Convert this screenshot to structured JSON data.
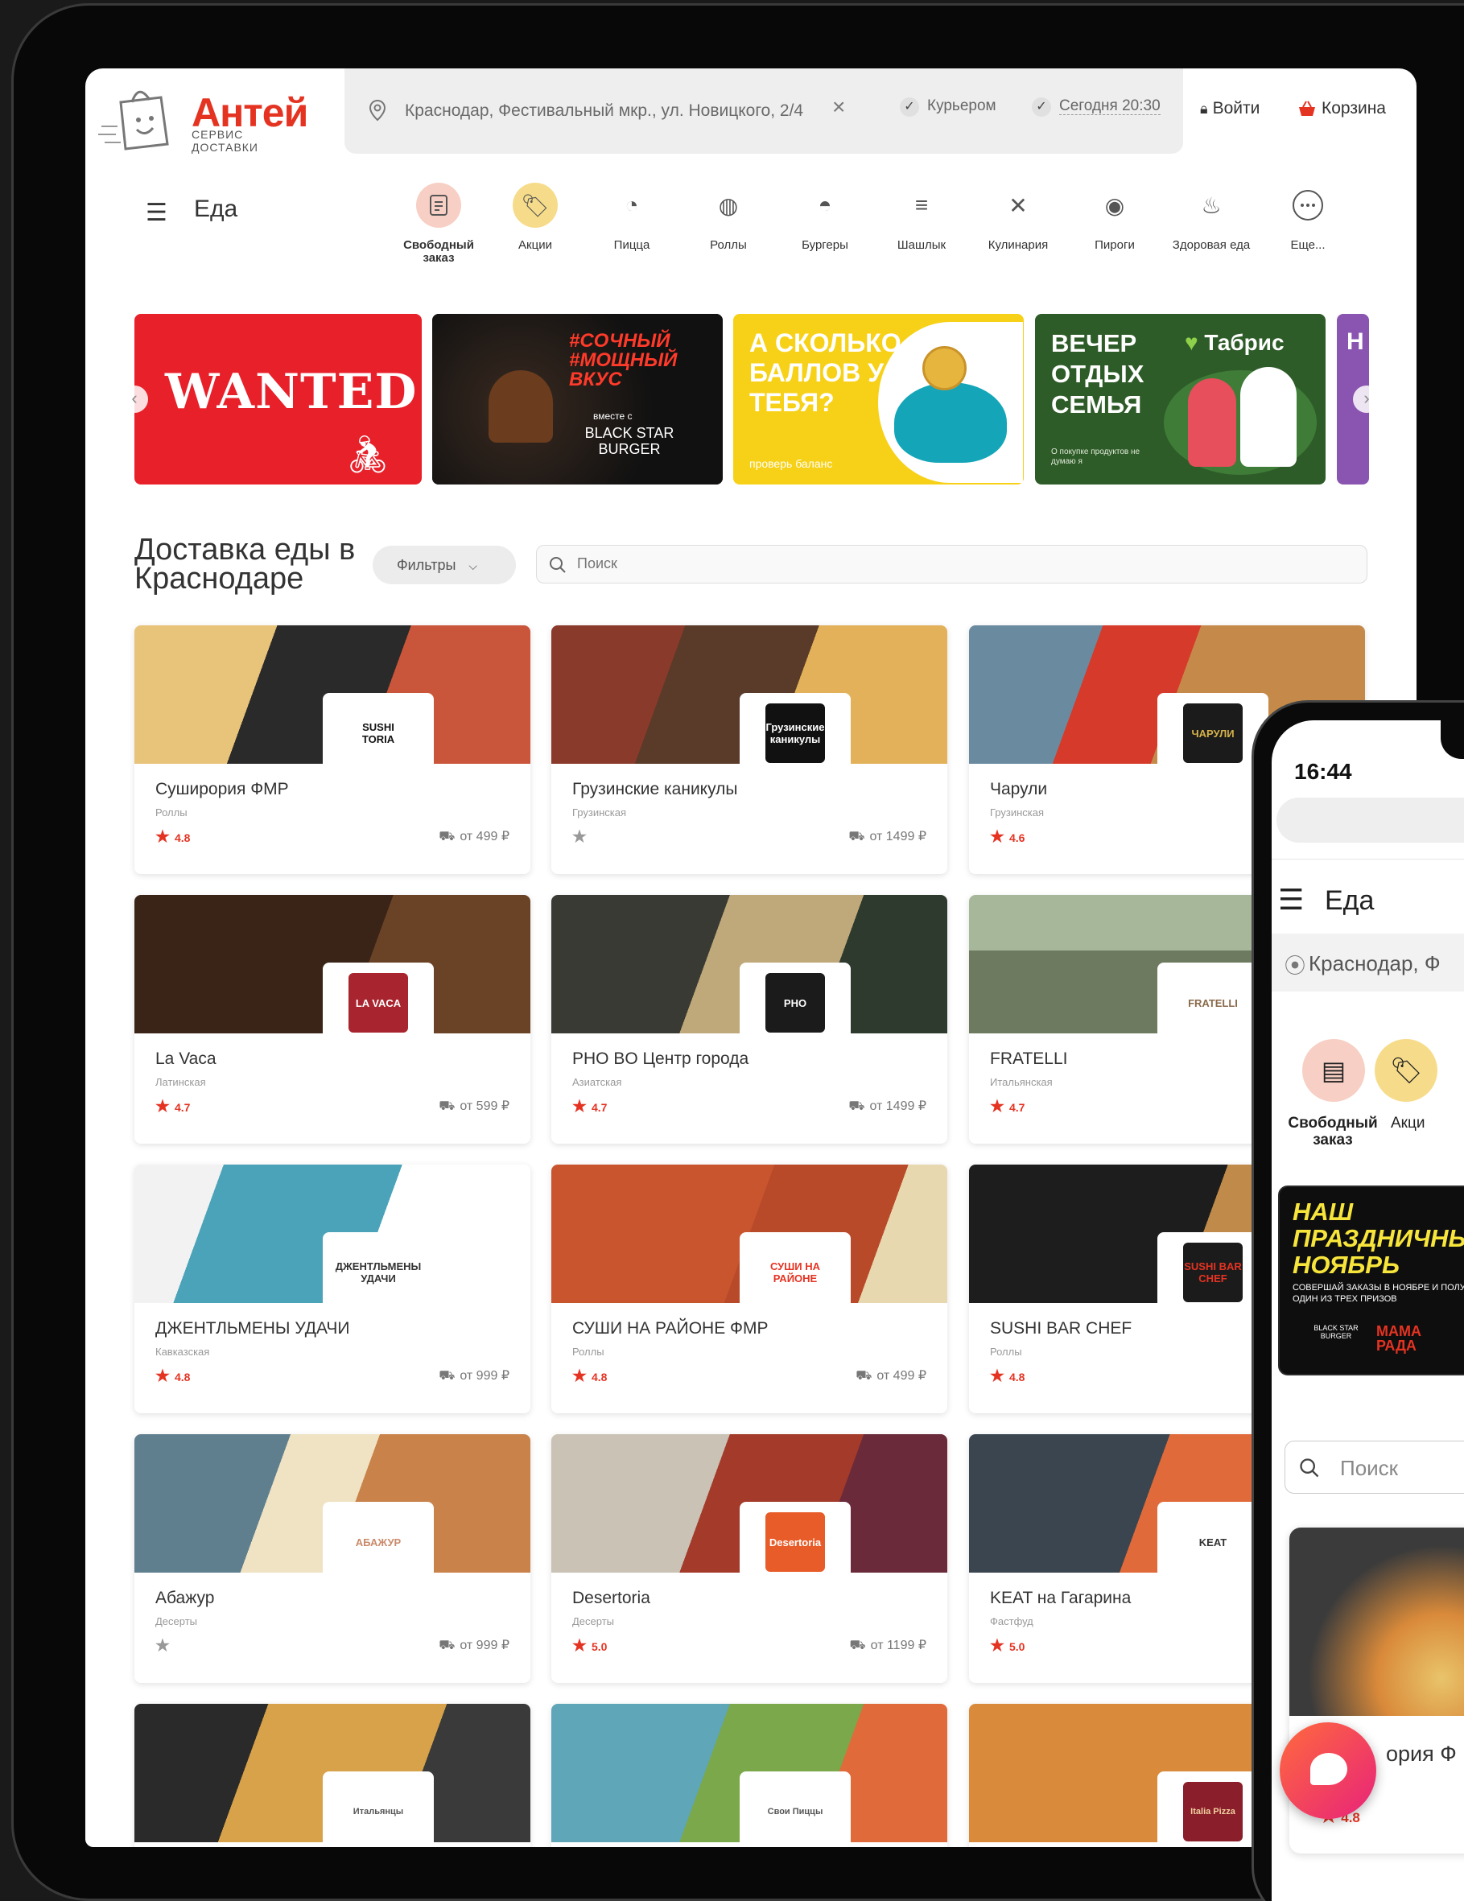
{
  "header": {
    "logo_name": "Антей",
    "logo_sub": "СЕРВИС ДОСТАВКИ",
    "address": "Краснодар, Фестивальный мкр., ул. Новицкого, 2/4",
    "delivery_mode": "Курьером",
    "delivery_time": "Сегодня 20:30",
    "login_label": "Войти",
    "cart_label": "Корзина"
  },
  "nav": {
    "menu_label": "Еда",
    "categories": [
      {
        "label": "Свободный заказ",
        "icon": "list-icon"
      },
      {
        "label": "Акции",
        "icon": "tag-icon"
      },
      {
        "label": "Пицца",
        "icon": "pizza-icon"
      },
      {
        "label": "Роллы",
        "icon": "rolls-icon"
      },
      {
        "label": "Бургеры",
        "icon": "burger-icon"
      },
      {
        "label": "Шашлык",
        "icon": "kebab-icon"
      },
      {
        "label": "Кулинария",
        "icon": "cooking-icon"
      },
      {
        "label": "Пироги",
        "icon": "pie-icon"
      },
      {
        "label": "Здоровая еда",
        "icon": "healthy-icon"
      },
      {
        "label": "Еще...",
        "icon": "more-icon"
      }
    ]
  },
  "banners": [
    {
      "text": "WANTED"
    },
    {
      "text": "#СОЧНЫЙ #МОЩНЫЙ ВКУС",
      "sub": "вместе с",
      "brand": "BLACK STAR BURGER"
    },
    {
      "text": "А СКОЛЬКО БАЛЛОВ У ТЕБЯ?",
      "sub": "проверь баланс"
    },
    {
      "text": "ВЕЧЕР ОТДЫХ СЕМЬЯ",
      "brand": "Табрис",
      "sub": "О покупке продуктов не думаю я"
    },
    {
      "text": "Н"
    }
  ],
  "section": {
    "title": "Доставка еды в Краснодаре",
    "filter_label": "Фильтры",
    "search_placeholder": "Поиск"
  },
  "restaurants": [
    {
      "name": "Суширория ФМР",
      "cuisine": "Роллы",
      "rating": "4.8",
      "price": "от 499 ₽",
      "logo": "SUSHI TORIA"
    },
    {
      "name": "Грузинские каникулы",
      "cuisine": "Грузинская",
      "rating": "",
      "price": "от 1499 ₽",
      "logo": "Грузинские каникулы"
    },
    {
      "name": "Чарули",
      "cuisine": "Грузинская",
      "rating": "4.6",
      "price": "",
      "logo": "ЧАРУЛИ"
    },
    {
      "name": "La Vaca",
      "cuisine": "Латинская",
      "rating": "4.7",
      "price": "от 599 ₽",
      "logo": "LA VACA"
    },
    {
      "name": "PHO BO Центр города",
      "cuisine": "Азиатская",
      "rating": "4.7",
      "price": "от 1499 ₽",
      "logo": "PHO"
    },
    {
      "name": "FRATELLI",
      "cuisine": "Итальянская",
      "rating": "4.7",
      "price": "",
      "logo": "FRATELLI"
    },
    {
      "name": "ДЖЕНТЛЬМЕНЫ УДАЧИ",
      "cuisine": "Кавказская",
      "rating": "4.8",
      "price": "от 999 ₽",
      "logo": "ДЖЕНТЛЬМЕНЫ УДАЧИ"
    },
    {
      "name": "СУШИ НА РАЙОНЕ ФМР",
      "cuisine": "Роллы",
      "rating": "4.8",
      "price": "от 499 ₽",
      "logo": "СУШИ НА РАЙОНЕ"
    },
    {
      "name": "SUSHI BAR CHEF",
      "cuisine": "Роллы",
      "rating": "4.8",
      "price": "",
      "logo": "SUSHI BAR CHEF"
    },
    {
      "name": "Абажур",
      "cuisine": "Десерты",
      "rating": "",
      "price": "от 999 ₽",
      "logo": "АБАЖУР"
    },
    {
      "name": "Desertoria",
      "cuisine": "Десерты",
      "rating": "5.0",
      "price": "от 1199 ₽",
      "logo": "Desertoria"
    },
    {
      "name": "KEAT на Гагарина",
      "cuisine": "Фастфуд",
      "rating": "5.0",
      "price": "",
      "logo": "KEAT"
    }
  ],
  "bottom_row_logos": [
    "Итальянцы",
    "Свои Пиццы",
    "Italia Pizza"
  ],
  "phone": {
    "time": "16:44",
    "menu_label": "Еда",
    "address": "Краснодар, Ф",
    "cat1": "Свободный заказ",
    "cat2": "Акци",
    "banner_text": "НАШ ПРАЗДНИЧНЫ НОЯБРЬ",
    "banner_sub": "СОВЕРШАЙ ЗАКАЗЫ В НОЯБРЕ И ПОЛУЧИ ОДИН ИЗ ТРЕХ ПРИЗОВ",
    "banner_brand1": "BLACK STAR BURGER",
    "banner_brand2": "МАМА РАДА",
    "search_placeholder": "Поиск",
    "card_name": "ория Ф",
    "card_rating": "4.8"
  },
  "colors": {
    "accent": "#e53322",
    "header_bg": "#eeeeee"
  }
}
